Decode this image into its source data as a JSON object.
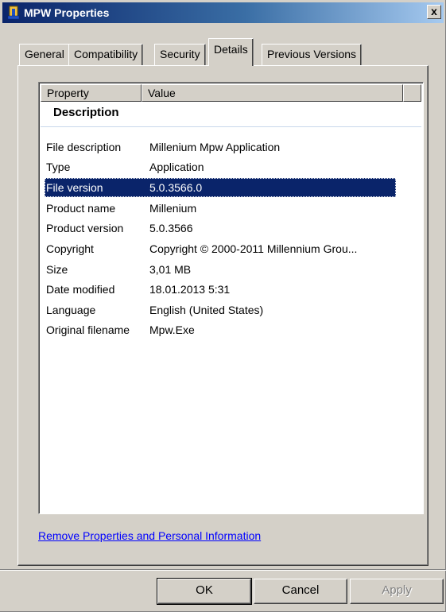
{
  "window": {
    "title": "MPW Properties",
    "close_label": "x"
  },
  "tabs": [
    {
      "label": "General"
    },
    {
      "label": "Compatibility"
    },
    {
      "label": "Security"
    },
    {
      "label": "Details",
      "active": true
    },
    {
      "label": "Previous Versions"
    }
  ],
  "list": {
    "columns": [
      "Property",
      "Value"
    ],
    "group": "Description",
    "rows": [
      {
        "name": "File description",
        "value": "Millenium Mpw Application"
      },
      {
        "name": "Type",
        "value": "Application"
      },
      {
        "name": "File version",
        "value": "5.0.3566.0",
        "selected": true
      },
      {
        "name": "Product name",
        "value": "Millenium"
      },
      {
        "name": "Product version",
        "value": "5.0.3566"
      },
      {
        "name": "Copyright",
        "value": "Copyright © 2000-2011 Millennium Grou..."
      },
      {
        "name": "Size",
        "value": "3,01 MB"
      },
      {
        "name": "Date modified",
        "value": "18.01.2013 5:31"
      },
      {
        "name": "Language",
        "value": "English (United States)"
      },
      {
        "name": "Original filename",
        "value": "Mpw.Exe"
      }
    ]
  },
  "link": "Remove Properties and Personal Information",
  "buttons": {
    "ok": "OK",
    "cancel": "Cancel",
    "apply": "Apply"
  },
  "colors": {
    "selection": "#0a246a",
    "title_gradient_start": "#0a246a",
    "dialog_face": "#d4d0c8",
    "link": "#0000ff"
  }
}
